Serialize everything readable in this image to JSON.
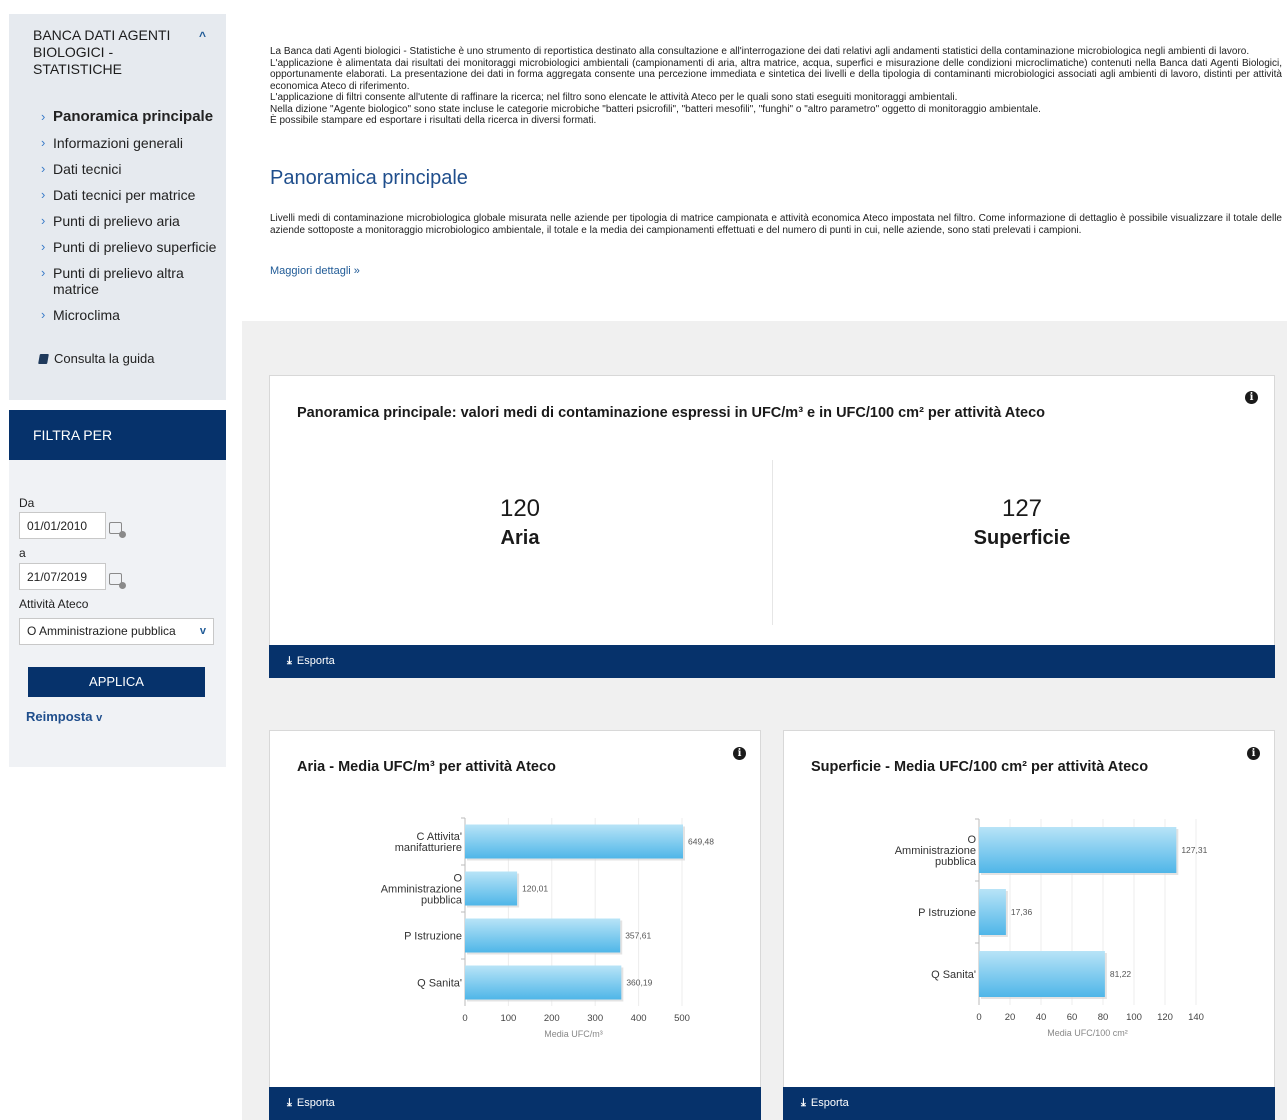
{
  "sidebar": {
    "title": "BANCA DATI AGENTI BIOLOGICI - STATISTICHE",
    "items": [
      {
        "label": "Panoramica principale"
      },
      {
        "label": "Informazioni generali"
      },
      {
        "label": "Dati tecnici"
      },
      {
        "label": "Dati tecnici per matrice"
      },
      {
        "label": "Punti di prelievo aria"
      },
      {
        "label": "Punti di prelievo superficie"
      },
      {
        "label": "Punti di prelievo altra matrice"
      },
      {
        "label": "Microclima"
      }
    ],
    "guide_label": "Consulta la guida"
  },
  "filter": {
    "title": "FILTRA PER",
    "from_label": "Da",
    "from_value": "01/01/2010",
    "to_label": "a",
    "to_value": "21/07/2019",
    "ateco_label": "Attività Ateco",
    "ateco_value": "O Amministrazione pubblica",
    "apply_label": "APPLICA",
    "reset_label": "Reimposta"
  },
  "intro": {
    "p1": "La Banca dati Agenti biologici - Statistiche è uno strumento di reportistica destinato alla consultazione e all'interrogazione dei dati relativi agli andamenti statistici della contaminazione microbiologica negli ambienti di lavoro.",
    "p2": "L'applicazione è alimentata dai risultati dei monitoraggi microbiologici ambientali (campionamenti di aria, altra matrice, acqua, superfici e misurazione delle condizioni microclimatiche) contenuti nella Banca dati Agenti Biologici, opportunamente elaborati. La presentazione dei dati in forma aggregata consente una percezione immediata e sintetica dei livelli e della tipologia di contaminanti microbiologici associati agli ambienti di lavoro, distinti per attività economica Ateco di riferimento.",
    "p3": "L'applicazione di filtri consente all'utente di raffinare la ricerca; nel filtro sono elencate le attività Ateco per le quali sono stati eseguiti monitoraggi ambientali.",
    "p4": "Nella dizione \"Agente biologico\" sono state incluse le categorie microbiche \"batteri psicrofili\", \"batteri mesofili\", \"funghi\" o \"altro parametro\" oggetto di monitoraggio ambientale.",
    "p5": "È possibile stampare ed esportare i risultati della ricerca in diversi formati."
  },
  "main": {
    "title": "Panoramica principale",
    "description": "Livelli medi di contaminazione microbiologica globale misurata nelle aziende per tipologia di matrice campionata e attività economica Ateco impostata nel filtro. Come informazione di dettaglio è possibile visualizzare il totale delle aziende sottoposte a monitoraggio microbiologico ambientale, il totale e la media dei campionamenti effettuati e del numero di punti in cui, nelle aziende, sono stati prelevati i campioni.",
    "more_link": "Maggiori dettagli »"
  },
  "overview_card": {
    "title": "Panoramica principale: valori medi di contaminazione espressi in UFC/m³ e in UFC/100 cm² per attività Ateco",
    "aria_value": "120",
    "aria_label": "Aria",
    "superficie_value": "127",
    "superficie_label": "Superficie",
    "export_label": "Esporta"
  },
  "aria_card": {
    "title": "Aria - Media UFC/m³ per attività Ateco",
    "export_label": "Esporta"
  },
  "superficie_card": {
    "title": "Superficie - Media UFC/100 cm² per attività Ateco",
    "export_label": "Esporta"
  },
  "chart_data": [
    {
      "type": "bar",
      "orientation": "horizontal",
      "categories": [
        [
          "C Attivita'",
          "manifatturiere"
        ],
        [
          "O",
          "Amministrazione",
          "pubblica"
        ],
        [
          "P Istruzione"
        ],
        [
          "Q Sanita'"
        ]
      ],
      "values": [
        649.48,
        120.01,
        357.61,
        360.19
      ],
      "value_labels": [
        "649,48",
        "120,01",
        "357,61",
        "360,19"
      ],
      "ticks": [
        "0",
        "100",
        "200",
        "300",
        "400",
        "500"
      ],
      "xlim": [
        0,
        500
      ],
      "xlabel": "Media UFC/m³",
      "title": "Aria - Media UFC/m³ per attività Ateco"
    },
    {
      "type": "bar",
      "orientation": "horizontal",
      "categories": [
        [
          "O",
          "Amministrazione",
          "pubblica"
        ],
        [
          "P Istruzione"
        ],
        [
          "Q Sanita'"
        ]
      ],
      "values": [
        127.31,
        17.36,
        81.22
      ],
      "value_labels": [
        "127,31",
        "17,36",
        "81,22"
      ],
      "ticks": [
        "0",
        "20",
        "40",
        "60",
        "80",
        "100",
        "120",
        "140"
      ],
      "xlim": [
        0,
        140
      ],
      "xlabel": "Media UFC/100 cm²",
      "title": "Superficie - Media UFC/100 cm² per attività Ateco"
    }
  ]
}
